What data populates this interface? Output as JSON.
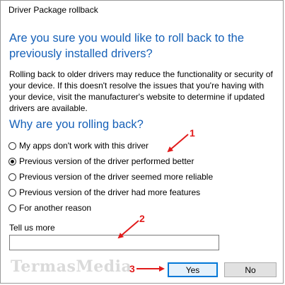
{
  "window": {
    "title": "Driver Package rollback"
  },
  "dialog": {
    "heading": "Are you sure you would like to roll back to the previously installed drivers?",
    "description": "Rolling back to older drivers may reduce the functionality or security of your device. If this doesn't resolve the issues that you're having with your device, visit the manufacturer's website to determine if updated drivers are available.",
    "question": "Why are you rolling back?",
    "options": [
      {
        "label": "My apps don't work with this driver",
        "selected": false
      },
      {
        "label": "Previous version of the driver performed better",
        "selected": true
      },
      {
        "label": "Previous version of the driver seemed more reliable",
        "selected": false
      },
      {
        "label": "Previous version of the driver had more features",
        "selected": false
      },
      {
        "label": "For another reason",
        "selected": false
      }
    ],
    "tell_more_label": "Tell us more",
    "tell_more_value": "",
    "yes_label": "Yes",
    "no_label": "No"
  },
  "annotations": {
    "marker_1": "1",
    "marker_2": "2",
    "marker_3": "3",
    "color": "#e11b1b"
  },
  "watermark": {
    "text": "TermasMedia"
  },
  "colors": {
    "heading_blue": "#1560b8",
    "focus_blue": "#0078d7"
  }
}
